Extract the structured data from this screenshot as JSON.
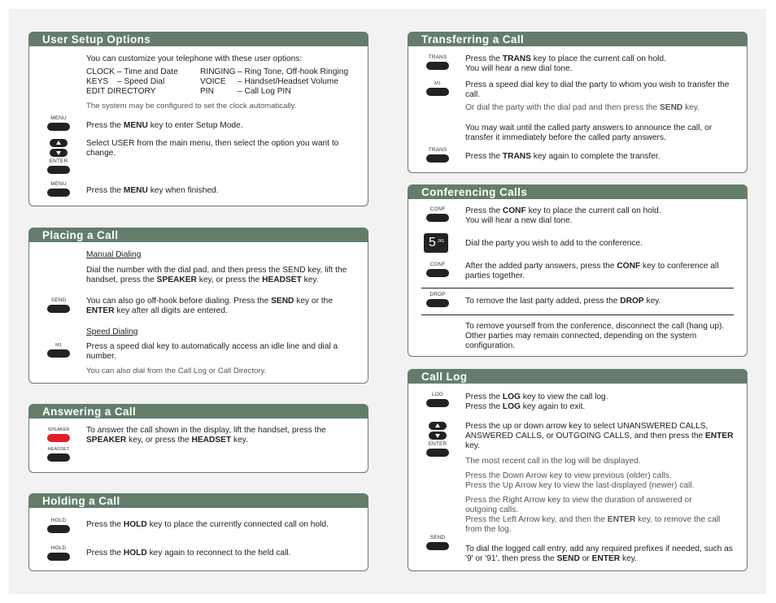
{
  "colors": {
    "header": "#647d6a",
    "speaker_key": "#e3202a",
    "key": "#222222"
  },
  "user_setup": {
    "title": "User Setup Options",
    "intro": "You can customize your telephone with these user options:",
    "options": [
      {
        "c1a": "CLOCK",
        "c1b": "– Time and Date",
        "c2a": "RINGING",
        "c2b": "– Ring Tone, Off-hook Ringing"
      },
      {
        "c1a": "KEYS",
        "c1b": "– Speed Dial",
        "c2a": "VOICE",
        "c2b": "– Handset/Headset Volume"
      },
      {
        "c1a": "EDIT DIRECTORY",
        "c1b": "",
        "c2a": "PIN",
        "c2b": "– Call Log PIN"
      }
    ],
    "note": "The system may be configured to set the clock automatically.",
    "step1": {
      "key": "MENU",
      "pre": "Press the ",
      "bold": "MENU",
      "post": " key to enter Setup Mode."
    },
    "step2": {
      "key": "ENTER",
      "text": "Select USER from the main menu, then select the option you want to change."
    },
    "step3": {
      "key": "MENU",
      "pre": "Press the ",
      "bold": "MENU",
      "post": " key when finished."
    }
  },
  "placing": {
    "title": "Placing a Call",
    "manual_heading": "Manual Dialing",
    "manual_p1_a": "Dial the number with the dial pad, and then press the SEND key, lift the handset, press the ",
    "manual_p1_b": "SPEAKER",
    "manual_p1_c": " key, or press the ",
    "manual_p1_d": "HEADSET",
    "manual_p1_e": " key.",
    "send_key": "SEND",
    "manual_p2_a": "You can also go off-hook before dialing. Press the ",
    "manual_p2_b": "SEND",
    "manual_p2_c": " key or the ",
    "manual_p2_d": "ENTER",
    "manual_p2_e": " key after all digits are entered.",
    "speed_heading": "Speed Dialing",
    "m1_key": "M1",
    "speed_p1": "Press a speed dial key to automatically access an idle line and dial a number.",
    "speed_note": "You can also dial from the Call Log or Call Directory."
  },
  "answering": {
    "title": "Answering a Call",
    "speaker_key": "SPEAKER",
    "headset_key": "HEADSET",
    "p_a": "To answer the call shown in the display, lift the handset, press the ",
    "p_b": "SPEAKER",
    "p_c": " key, or press the ",
    "p_d": "HEADSET",
    "p_e": " key."
  },
  "holding": {
    "title": "Holding a Call",
    "key": "HOLD",
    "s1_a": "Press the ",
    "s1_b": "HOLD",
    "s1_c": " key to place the currently connected call on hold.",
    "s2_a": "Press the ",
    "s2_b": "HOLD",
    "s2_c": " key again to reconnect to the held call."
  },
  "transfer": {
    "title": "Transferring a Call",
    "trans_key": "TRANS",
    "m1_key": "M1",
    "s1_a": "Press the ",
    "s1_b": "TRANS",
    "s1_c": " key to place the current call on hold.",
    "s1_d": "You will hear a new dial tone.",
    "s2": "Press a speed dial key to dial the party to whom you wish to transfer the call.",
    "s2_note_a": "Or dial the party with the dial pad and then press the ",
    "s2_note_b": "SEND",
    "s2_note_c": " key.",
    "s3": "You may wait until the called party answers to announce the call, or transfer it immediately before the called party answers.",
    "s4_a": "Press the ",
    "s4_b": "TRANS",
    "s4_c": " key again to complete the transfer."
  },
  "conference": {
    "title": "Conferencing Calls",
    "conf_key": "CONF",
    "drop_key": "DROP",
    "digit": "5",
    "digit_letters": "JKL",
    "s1_a": "Press the ",
    "s1_b": "CONF",
    "s1_c": " key to place the current call on hold.",
    "s1_d": "You will hear a new dial tone.",
    "s2": "Dial the party you wish to add to the conference.",
    "s3_a": "After the added party answers, press the ",
    "s3_b": "CONF",
    "s3_c": " key to conference all parties together.",
    "s4_a": "To remove the last party added, press the ",
    "s4_b": "DROP",
    "s4_c": " key.",
    "s5": "To remove yourself from the conference, disconnect the call (hang up). Other parties may remain connected, depending on the system configuration."
  },
  "call_log": {
    "title": "Call Log",
    "log_key": "LOG",
    "enter_key": "ENTER",
    "send_key": "SEND",
    "s1_a": "Press the ",
    "s1_b": "LOG",
    "s1_c": " key to view the call log.",
    "s1_d": "Press the ",
    "s1_e": "LOG",
    "s1_f": " key again to exit.",
    "s2_a": "Press the up or down arrow key to select UNANSWERED CALLS, ANSWERED CALLS, or OUTGOING CALLS, and then press the ",
    "s2_b": "ENTER",
    "s2_c": " key.",
    "n1": "The most recent call in the log will be displayed.",
    "n2": "Press the Down Arrow key to view previous (older) calls.",
    "n3": "Press the Up Arrow key to view the last-displayed (newer) call.",
    "n4": "Press the Right Arrow key to view the duration of answered or outgoing calls.",
    "n5_a": "Press the Left Arrow key, and then the ",
    "n5_b": "ENTER",
    "n5_c": " key, to remove the call from the log.",
    "s3_a": "To dial the logged call entry, add any required prefixes if needed, such as '9' or '91', then press the ",
    "s3_b": "SEND",
    "s3_c": " or ",
    "s3_d": "ENTER",
    "s3_e": " key."
  }
}
